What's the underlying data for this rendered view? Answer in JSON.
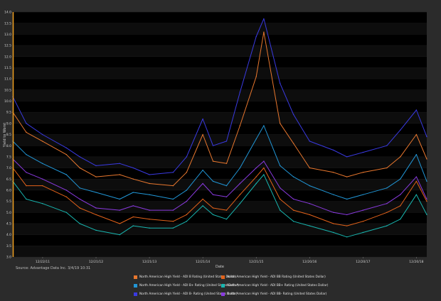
{
  "source": "Source: Advantage Data Inc. 3/4/19 10:31",
  "chart_data": {
    "type": "line",
    "title": "",
    "xlabel": "Date",
    "ylabel": "Yield to Worst",
    "ylim": [
      3.0,
      14.0
    ],
    "yticks": [
      "3.0",
      "3.5",
      "4.0",
      "4.5",
      "5.0",
      "5.5",
      "6.0",
      "6.5",
      "7.0",
      "7.5",
      "8.0",
      "8.5",
      "9.0",
      "9.5",
      "10.0",
      "10.5",
      "11.0",
      "11.5",
      "12.0",
      "12.5",
      "13.0",
      "13.5",
      "14.0"
    ],
    "x": [
      "2011-06-01",
      "2011-09-01",
      "2011-12-21",
      "2012-06-01",
      "2012-09-01",
      "2012-12-21",
      "2013-06-01",
      "2013-09-01",
      "2013-12-21",
      "2014-06-01",
      "2014-09-01",
      "2014-12-21",
      "2015-03-01",
      "2015-06-01",
      "2015-09-01",
      "2015-12-21",
      "2016-02-11",
      "2016-06-01",
      "2016-09-01",
      "2016-12-20",
      "2017-06-01",
      "2017-09-01",
      "2017-12-20",
      "2018-06-01",
      "2018-09-01",
      "2018-12-20",
      "2019-03-01"
    ],
    "xticks": [
      "12/22/11",
      "12/21/12",
      "12/21/13",
      "12/21/14",
      "12/21/15",
      "12/20/16",
      "12/20/17",
      "12/20/18"
    ],
    "legend_position": "bottom",
    "grid": true,
    "series": [
      {
        "name": "North American High Yield - ADI B Rating (United States Dollar)",
        "color": "#e8772e",
        "values": [
          9.5,
          8.6,
          8.2,
          7.6,
          7.0,
          6.6,
          6.7,
          6.5,
          6.3,
          6.2,
          6.8,
          8.5,
          7.3,
          7.2,
          8.9,
          11.1,
          13.1,
          9.0,
          8.1,
          7.0,
          6.8,
          6.6,
          6.8,
          7.0,
          7.5,
          8.5,
          7.4
        ]
      },
      {
        "name": "North American High Yield - ADI BB Rating (United States Dollar)",
        "color": "#e2621a",
        "values": [
          7.0,
          6.2,
          6.2,
          5.7,
          5.2,
          4.9,
          4.5,
          4.8,
          4.7,
          4.6,
          4.9,
          5.6,
          5.2,
          5.1,
          5.8,
          6.6,
          7.0,
          5.6,
          5.1,
          4.9,
          4.5,
          4.4,
          4.6,
          5.0,
          5.3,
          6.4,
          5.5
        ]
      },
      {
        "name": "North American High Yield - ADI B+ Rating (United States Dollar)",
        "color": "#2196d6",
        "values": [
          8.2,
          7.6,
          7.2,
          6.7,
          6.1,
          5.9,
          5.6,
          5.9,
          5.8,
          5.6,
          6.0,
          6.9,
          6.4,
          6.2,
          7.0,
          8.3,
          8.9,
          7.1,
          6.6,
          6.2,
          5.8,
          5.6,
          5.8,
          6.1,
          6.5,
          7.6,
          6.4
        ]
      },
      {
        "name": "North American High Yield - ADI BB+ Rating (United States Dollar)",
        "color": "#18b6b0",
        "values": [
          6.4,
          5.6,
          5.4,
          5.0,
          4.5,
          4.2,
          4.0,
          4.4,
          4.3,
          4.3,
          4.6,
          5.3,
          4.9,
          4.7,
          5.4,
          6.3,
          6.7,
          5.1,
          4.6,
          4.4,
          4.1,
          3.9,
          4.1,
          4.4,
          4.7,
          5.8,
          4.9
        ]
      },
      {
        "name": "North American High Yield - ADI B- Rating (United States Dollar)",
        "color": "#3a3ae2",
        "values": [
          10.2,
          9.0,
          8.5,
          7.9,
          7.5,
          7.1,
          7.2,
          7.0,
          6.7,
          6.8,
          7.5,
          9.2,
          8.0,
          8.2,
          10.4,
          12.9,
          13.7,
          10.8,
          9.4,
          8.2,
          7.8,
          7.5,
          7.7,
          8.0,
          8.7,
          9.6,
          8.4
        ]
      },
      {
        "name": "North American High Yield - ADI BB- Rating (United States Dollar)",
        "color": "#8a3ae0",
        "values": [
          7.4,
          6.8,
          6.5,
          6.0,
          5.6,
          5.2,
          5.1,
          5.3,
          5.1,
          5.1,
          5.5,
          6.3,
          5.8,
          5.7,
          6.3,
          7.0,
          7.3,
          6.1,
          5.6,
          5.4,
          5.0,
          4.9,
          5.1,
          5.4,
          5.8,
          6.6,
          5.6
        ]
      }
    ]
  }
}
